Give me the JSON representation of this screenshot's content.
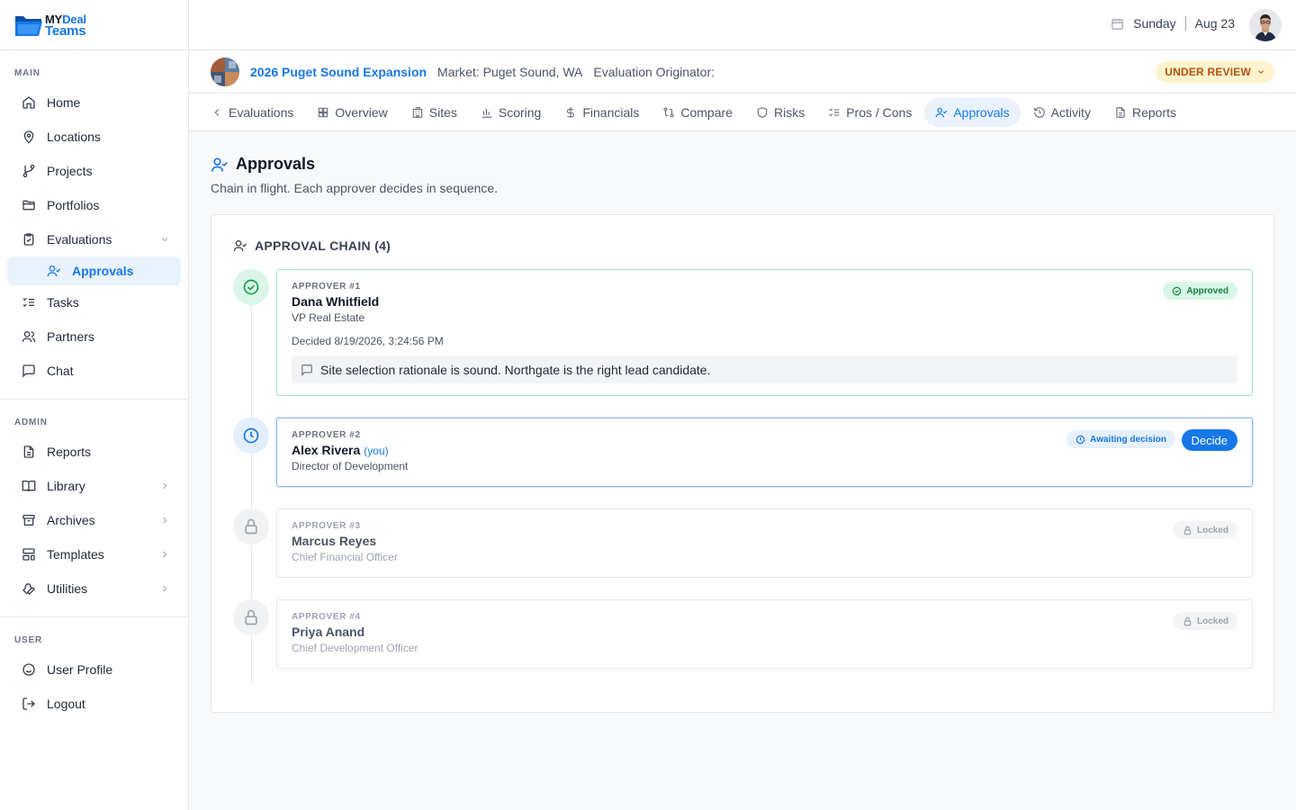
{
  "brand": {
    "line1_a": "MY",
    "line1_b": "Deal",
    "line2": "Teams"
  },
  "sidebar": {
    "main_title": "MAIN",
    "main": [
      {
        "label": "Home",
        "icon": "home-icon"
      },
      {
        "label": "Locations",
        "icon": "map-pin-icon"
      },
      {
        "label": "Projects",
        "icon": "git-branch-icon"
      },
      {
        "label": "Portfolios",
        "icon": "folder-icon"
      },
      {
        "label": "Evaluations",
        "icon": "clipboard-check-icon"
      }
    ],
    "sub_active": "Approvals",
    "main_after": [
      {
        "label": "Tasks",
        "icon": "list-checks-icon"
      },
      {
        "label": "Partners",
        "icon": "users-icon"
      },
      {
        "label": "Chat",
        "icon": "message-square-icon"
      }
    ],
    "admin_title": "ADMIN",
    "admin": [
      {
        "label": "Reports",
        "icon": "file-text-icon"
      },
      {
        "label": "Library",
        "icon": "book-open-icon"
      },
      {
        "label": "Archives",
        "icon": "archive-icon"
      },
      {
        "label": "Templates",
        "icon": "layout-template-icon"
      },
      {
        "label": "Utilities",
        "icon": "wrench-icon"
      }
    ],
    "user_title": "USER",
    "user": [
      {
        "label": "User Profile",
        "icon": "smile-icon"
      },
      {
        "label": "Logout",
        "icon": "log-out-icon"
      }
    ]
  },
  "topbar": {
    "day": "Sunday",
    "date": "Aug 23"
  },
  "project": {
    "name": "2026 Puget Sound Expansion",
    "market": "Market: Puget Sound, WA",
    "originator": "Evaluation Originator:",
    "status": "UNDER REVIEW"
  },
  "tabs": [
    "Evaluations",
    "Overview",
    "Sites",
    "Scoring",
    "Financials",
    "Compare",
    "Risks",
    "Pros / Cons",
    "Approvals",
    "Activity",
    "Reports"
  ],
  "page": {
    "title": "Approvals",
    "subtitle": "Chain in flight. Each approver decides in sequence.",
    "chain_title": "APPROVAL CHAIN (4)"
  },
  "approvers": [
    {
      "num": "APPROVER #1",
      "name": "Dana Whitfield",
      "role": "VP Real Estate",
      "decided": "Decided 8/19/2026, 3:24:56 PM",
      "comment": "Site selection rationale is sound. Northgate is the right lead candidate.",
      "badge": "Approved"
    },
    {
      "num": "APPROVER #2",
      "name": "Alex Rivera",
      "you": "(you)",
      "role": "Director of Development",
      "badge": "Awaiting decision",
      "action": "Decide"
    },
    {
      "num": "APPROVER #3",
      "name": "Marcus Reyes",
      "role": "Chief Financial Officer",
      "badge": "Locked"
    },
    {
      "num": "APPROVER #4",
      "name": "Priya Anand",
      "role": "Chief Development Officer",
      "badge": "Locked"
    }
  ],
  "colors": {
    "accent": "#1677e6",
    "approved": "#16a34a",
    "review": "#b45309"
  }
}
